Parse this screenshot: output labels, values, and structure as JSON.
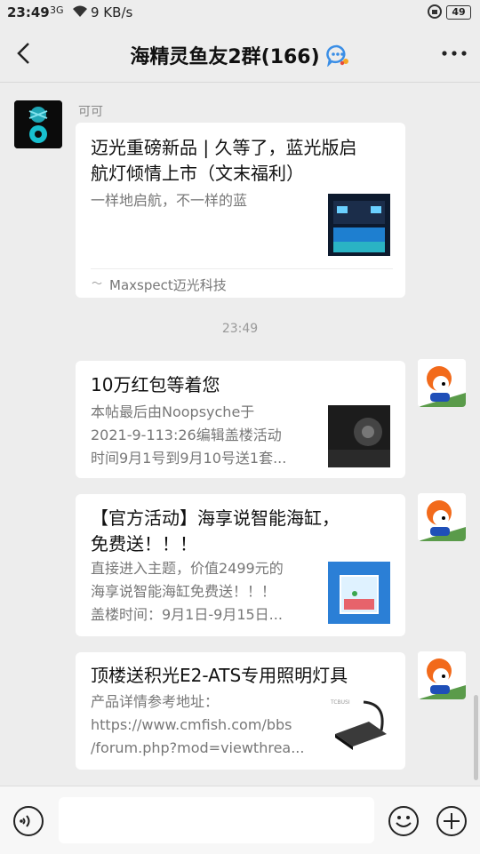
{
  "status": {
    "time": "23:49",
    "signal": "3G",
    "speed": "9 KB/s",
    "battery": "49"
  },
  "header": {
    "title": "海精灵鱼友2群(166)"
  },
  "messages": [
    {
      "sender": "可可",
      "title_line1": "迈光重磅新品 | 久等了，蓝光版启",
      "title_line2": "航灯倾情上市（文末福利）",
      "desc_line1": "一样地启航，不一样的蓝",
      "source": "Maxspect迈光科技"
    },
    {
      "title_line1": "10万红包等着您",
      "desc_line1": "本帖最后由Noopsyche于",
      "desc_line2": "2021-9-113:26编辑盖楼活动",
      "desc_line3": "时间9月1号到9月10号送1套..."
    },
    {
      "title_line1": "【官方活动】海享说智能海缸，",
      "title_line2": "免费送！！！",
      "desc_line1": "直接进入主题，价值2499元的",
      "desc_line2": "海享说智能海缸免费送！！！",
      "desc_line3": "盖楼时间：9月1日-9月15日..."
    },
    {
      "title_line1": "顶楼送积光E2-ATS专用照明灯具",
      "desc_line1": "产品详情参考地址：",
      "desc_line2": "https://www.cmfish.com/bbs",
      "desc_line3": "/forum.php?mod=viewthrea..."
    }
  ],
  "timestamp": "23:49",
  "thumb4_brand": "TCBUSI",
  "colors": {
    "background": "#ededed",
    "card": "#ffffff",
    "title_text": "#111111",
    "desc_text": "#777777"
  }
}
